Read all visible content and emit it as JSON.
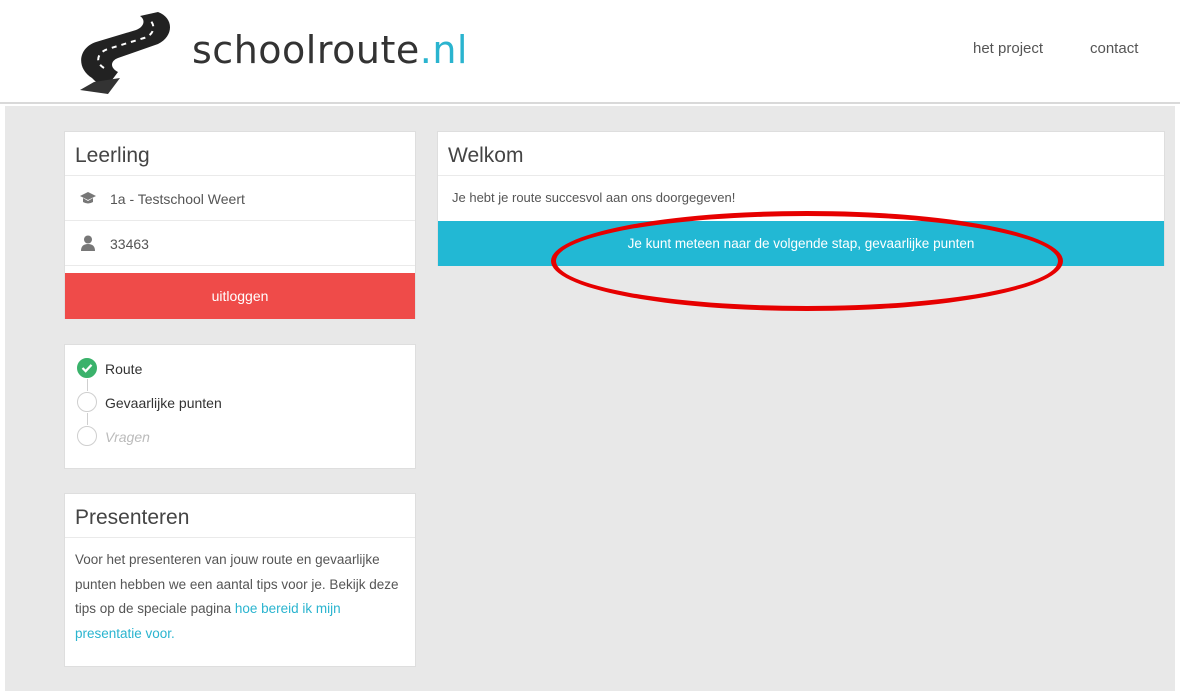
{
  "header": {
    "brand_name": "schoolroute",
    "brand_tld": ".nl",
    "nav": [
      "het project",
      "contact"
    ]
  },
  "leerling": {
    "title": "Leerling",
    "school": "1a - Testschool Weert",
    "school_icon": "graduation-cap-icon",
    "user_id": "33463",
    "user_icon": "user-icon",
    "logout_label": "uitloggen"
  },
  "steps": [
    {
      "label": "Route",
      "status": "done"
    },
    {
      "label": "Gevaarlijke punten",
      "status": "active"
    },
    {
      "label": "Vragen",
      "status": "disabled"
    }
  ],
  "presenteren": {
    "title": "Presenteren",
    "text_before": "Voor het presenteren van jouw route en gevaarlijke punten hebben we een aantal tips voor je. Bekijk deze tips op de speciale pagina ",
    "link_label": "hoe bereid ik mijn presentatie voor."
  },
  "welkom": {
    "title": "Welkom",
    "message": "Je hebt je route succesvol aan ons doorgegeven!",
    "next_button_label": "Je kunt meteen naar de volgende stap, gevaarlijke punten"
  },
  "colors": {
    "accent": "#22b8d4",
    "logout": "#ef4b49",
    "done": "#3ab26b",
    "annotation": "#e60000"
  }
}
